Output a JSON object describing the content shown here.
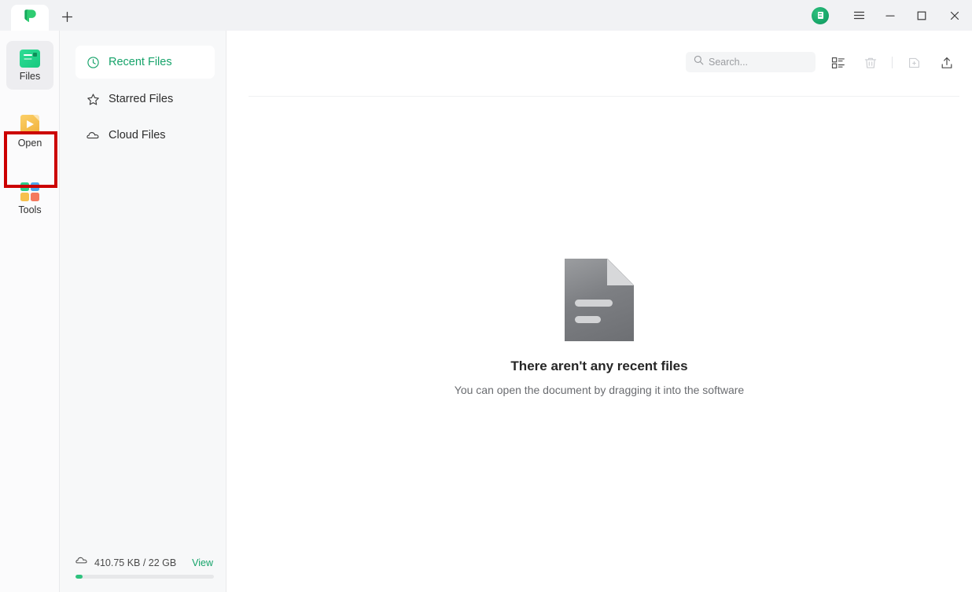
{
  "window": {
    "tab_logo_icon": "app-logo-green-leaf",
    "new_tab_label": "+",
    "avatar_icon": "user-avatar",
    "menu_icon": "hamburger-menu-icon",
    "minimize_icon": "minimize-icon",
    "maximize_icon": "maximize-icon",
    "close_icon": "close-icon"
  },
  "rail": {
    "items": [
      {
        "id": "files",
        "label": "Files",
        "icon": "files-icon",
        "active": true,
        "highlighted": false
      },
      {
        "id": "open",
        "label": "Open",
        "icon": "open-folder-icon",
        "active": false,
        "highlighted": true
      },
      {
        "id": "tools",
        "label": "Tools",
        "icon": "tools-grid-icon",
        "active": false,
        "highlighted": false
      }
    ],
    "highlight_color": "#cc0000"
  },
  "nav": {
    "items": [
      {
        "id": "recent",
        "label": "Recent Files",
        "icon": "clock-icon",
        "active": true
      },
      {
        "id": "starred",
        "label": "Starred Files",
        "icon": "star-icon",
        "active": false
      },
      {
        "id": "cloud",
        "label": "Cloud Files",
        "icon": "cloud-icon",
        "active": false
      }
    ],
    "active_color": "#16a36a"
  },
  "storage": {
    "icon": "cloud-icon",
    "usage_text": "410.75 KB / 22 GB",
    "view_label": "View",
    "percent": 0
  },
  "toolbar": {
    "search": {
      "icon": "search-icon",
      "placeholder": "Search...",
      "value": ""
    },
    "buttons": [
      {
        "id": "view",
        "icon": "list-view-icon",
        "enabled": true
      },
      {
        "id": "trash",
        "icon": "trash-icon",
        "enabled": false
      },
      {
        "id": "new-folder",
        "icon": "new-folder-icon",
        "enabled": false
      },
      {
        "id": "upload",
        "icon": "upload-icon",
        "enabled": true
      }
    ]
  },
  "empty_state": {
    "icon": "document-placeholder-icon",
    "title": "There aren't any recent files",
    "subtitle": "You can open the document by dragging it into the software"
  }
}
